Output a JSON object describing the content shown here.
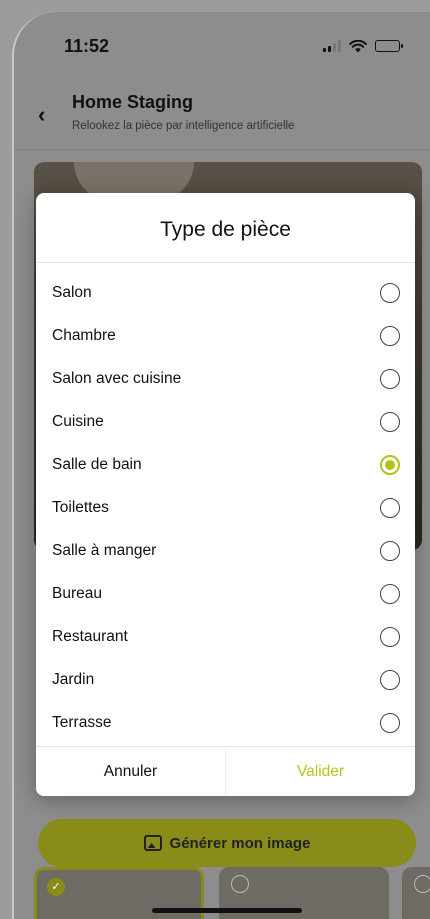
{
  "status_bar": {
    "time": "11:52"
  },
  "header": {
    "back_icon": "chevron-left-icon",
    "title": "Home Staging",
    "subtitle": "Relookez la pièce par intelligence artificielle"
  },
  "generate_button": {
    "label": "Générer mon image",
    "icon": "image-icon"
  },
  "modal": {
    "title": "Type de pièce",
    "selected_index": 4,
    "options": [
      "Salon",
      "Chambre",
      "Salon avec cuisine",
      "Cuisine",
      "Salle de bain",
      "Toilettes",
      "Salle à manger",
      "Bureau",
      "Restaurant",
      "Jardin",
      "Terrasse"
    ],
    "cancel_label": "Annuler",
    "confirm_label": "Valider"
  },
  "colors": {
    "accent": "#b3c218",
    "confirm_text": "#b8c61a"
  }
}
